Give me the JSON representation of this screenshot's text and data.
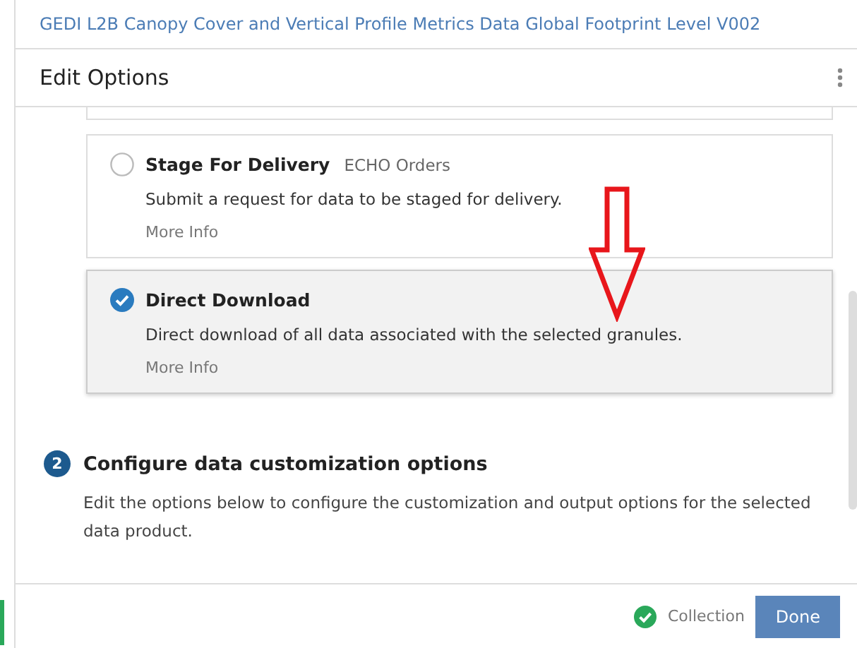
{
  "header": {
    "title": "GEDI L2B Canopy Cover and Vertical Profile Metrics Data Global Footprint Level V002"
  },
  "panel": {
    "title": "Edit Options"
  },
  "methods": [
    {
      "title": "Stage For Delivery",
      "subtitle": "ECHO Orders",
      "description": "Submit a request for data to be staged for delivery.",
      "link": "More Info",
      "selected": false
    },
    {
      "title": "Direct Download",
      "description": "Direct download of all data associated with the selected granules.",
      "link": "More Info",
      "selected": true
    }
  ],
  "section": {
    "number": "2",
    "title": "Configure data customization options",
    "description": "Edit the options below to configure the customization and output options for the selected data product."
  },
  "footer": {
    "status": "Collection",
    "button": "Done"
  }
}
